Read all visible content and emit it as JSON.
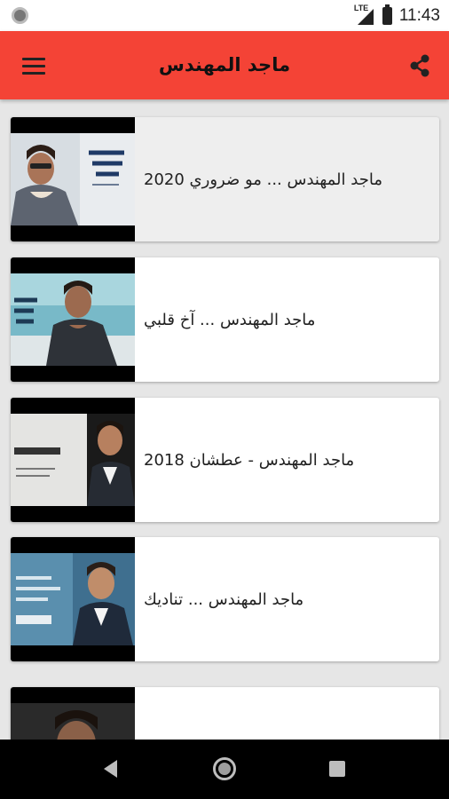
{
  "status_bar": {
    "network": "LTE",
    "time": "11:43"
  },
  "app_bar": {
    "title": "ماجد المهندس",
    "color": "#f44336",
    "menu_icon": "hamburger-menu-icon",
    "share_icon": "share-icon"
  },
  "videos": [
    {
      "title": "ماجد المهندس ... مو ضروري 2020",
      "pressed": true
    },
    {
      "title": "ماجد المهندس ... آخ قلبي",
      "pressed": false
    },
    {
      "title": "ماجد المهندس - عطشان 2018",
      "pressed": false
    },
    {
      "title": "ماجد المهندس ... تناديك",
      "pressed": false
    },
    {
      "title": "",
      "pressed": false
    }
  ],
  "nav_bar": {
    "back_icon": "back-icon",
    "home_icon": "home-icon",
    "recents_icon": "recents-icon"
  }
}
